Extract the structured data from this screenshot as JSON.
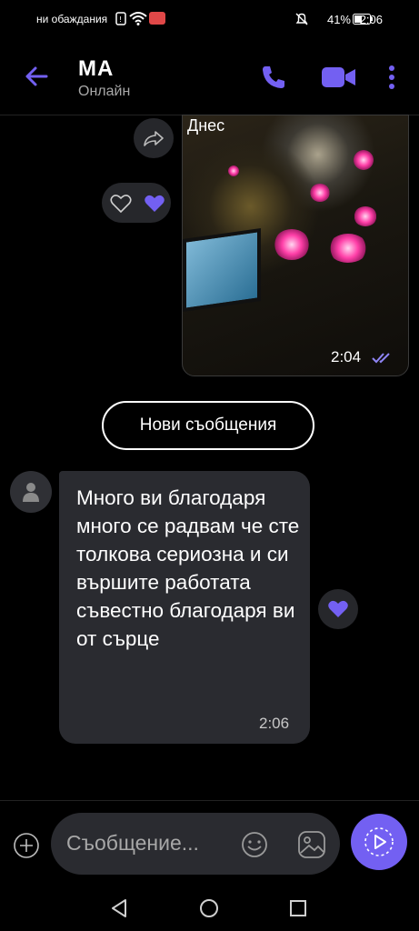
{
  "status_bar": {
    "left_text": "ни обаждания",
    "battery": "41%",
    "time": "2:06"
  },
  "header": {
    "title": "МА",
    "subtitle": "Онлайн"
  },
  "photo_message": {
    "day_label": "Днес",
    "time": "2:04"
  },
  "new_messages_label": "Нови съобщения",
  "incoming_message": {
    "text": "Много ви благодаря много се радвам че сте толкова сериозна и си вършите работата съвестно благодаря ви от сърце",
    "time": "2:06"
  },
  "composer": {
    "placeholder": "Съобщение..."
  },
  "colors": {
    "accent": "#7360f2",
    "bubble": "#2a2b30"
  }
}
